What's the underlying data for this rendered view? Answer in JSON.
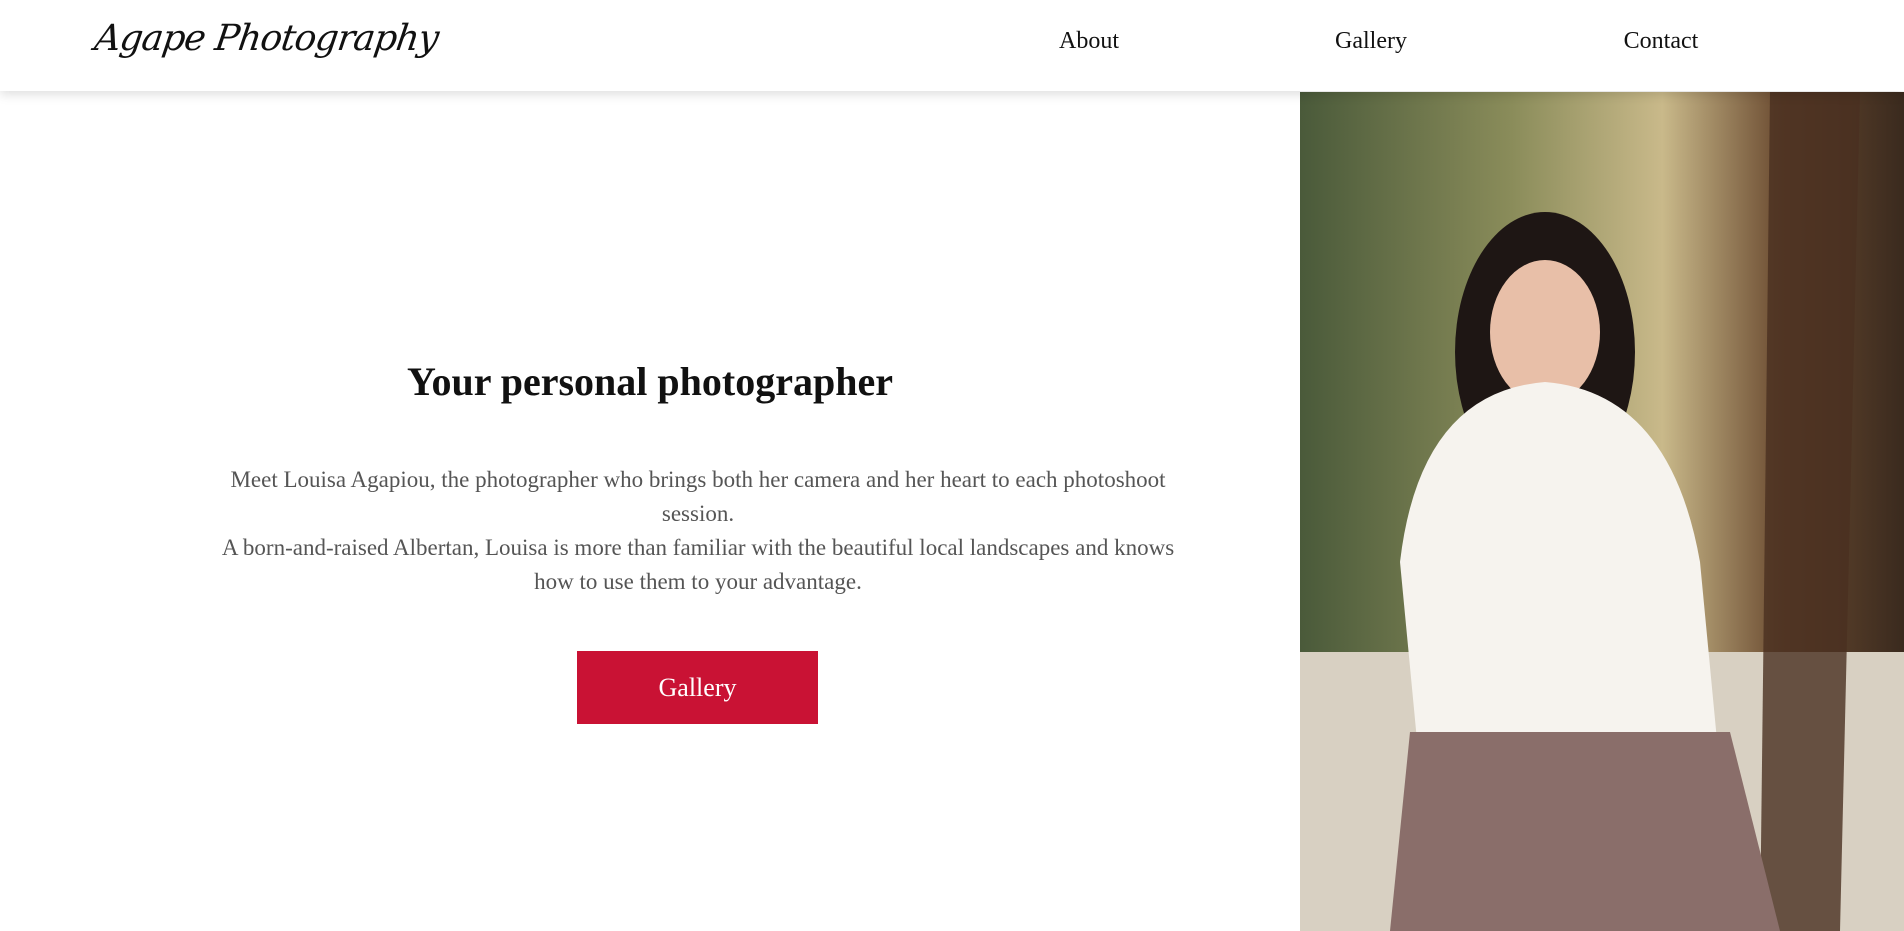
{
  "header": {
    "logo": "Agape Photography",
    "nav": [
      "About",
      "Gallery",
      "Contact"
    ]
  },
  "hero": {
    "title": "Your personal photographer",
    "paragraph_line1": "Meet Louisa Agapiou, the photographer who brings both her camera and her heart to each photoshoot session.",
    "paragraph_line2": "A born-and-raised Albertan, Louisa is more than familiar with the beautiful local landscapes and knows how to use them to your advantage.",
    "button": "Gallery"
  },
  "colors": {
    "accent": "#c91234"
  }
}
